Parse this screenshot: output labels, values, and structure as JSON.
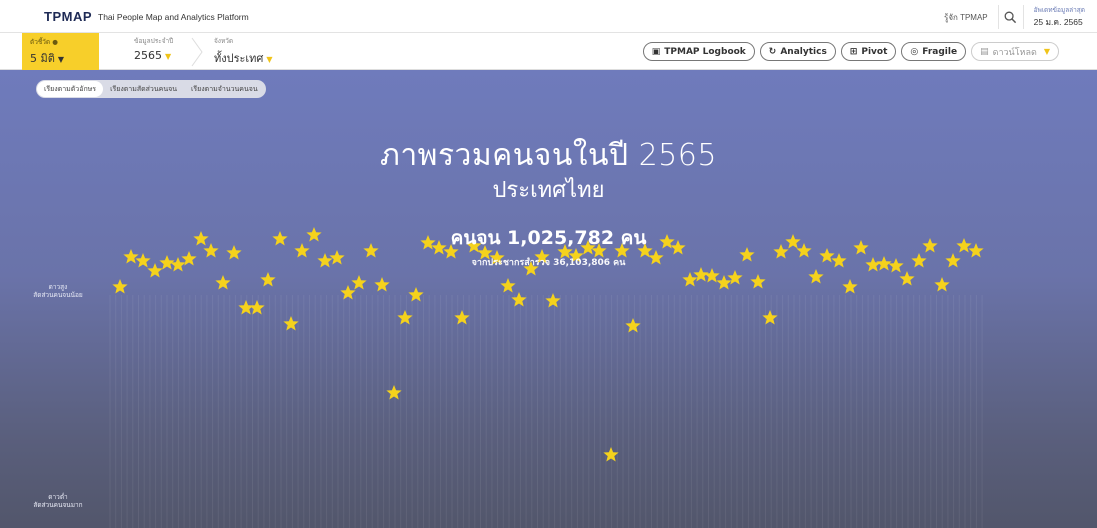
{
  "header": {
    "logo": "TPMAP",
    "platform": "Thai People Map and Analytics Platform",
    "about_link": "รู้จัก TPMAP",
    "updated_label": "อัพเดทข้อมูลล่าสุด",
    "updated_date": "25 ม.ค. 2565",
    "icons": [
      "search-icon"
    ]
  },
  "filters": {
    "index_label": "ตัวชี้วัด ●",
    "index_value": "5 มิติ",
    "data_year_label": "ข้อมูลประจำปี",
    "data_year_value": "2565",
    "province_label": "จังหวัด",
    "province_value": "ทั้งประเทศ"
  },
  "toolbar": {
    "logbook": "TPMAP Logbook",
    "analytics": "Analytics",
    "pivot": "Pivot",
    "fragile": "Fragile",
    "download": "ดาวน์โหลด"
  },
  "sort_tabs": [
    "เรียงตามตัวอักษร",
    "เรียงตามสัดส่วนคนจน",
    "เรียงตามจำนวนคนจน"
  ],
  "main": {
    "title_line1": "ภาพรวมคนจนในปี 2565",
    "title_line2": "ประเทศไทย",
    "poor_count": "คนจน 1,025,782 คน",
    "survey_count": "จากประชากรสำรวจ 36,103,806 คน",
    "axis_top": [
      "ดาวสูง",
      "สัดส่วนคนจนน้อย"
    ],
    "axis_bottom": [
      "ดาวต่ำ",
      "สัดส่วนคนจนมาก"
    ]
  },
  "colors": {
    "star": "#f5d21c",
    "accent_yellow": "#f7cf2a",
    "bg_top": "#6f7bbc",
    "bg_bottom": "#52566b"
  }
}
